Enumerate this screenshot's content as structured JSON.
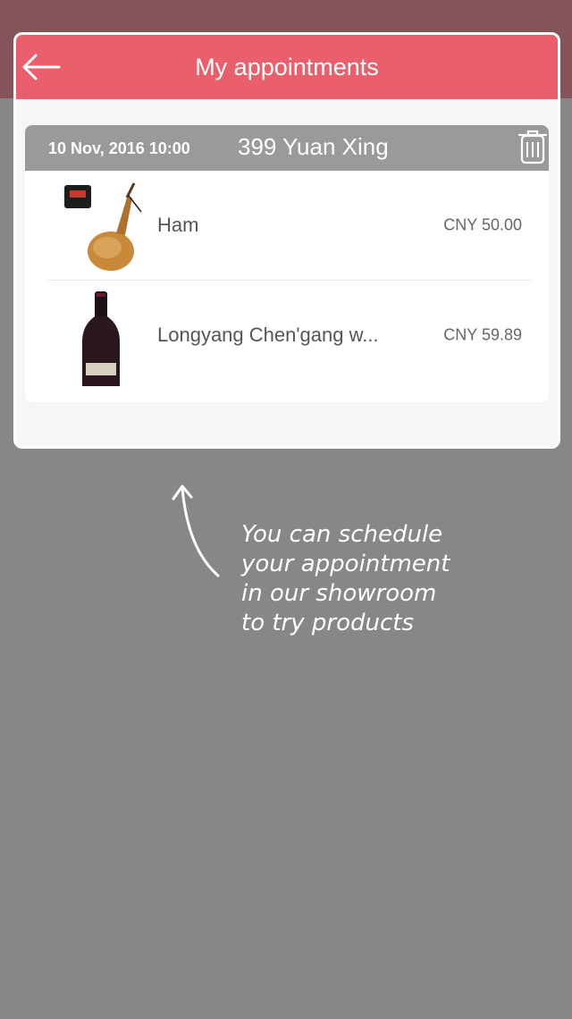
{
  "header": {
    "title": "My appointments"
  },
  "appointment": {
    "date": "10 Nov, 2016 10:00",
    "location": "399 Yuan Xing",
    "items": [
      {
        "name": "Ham",
        "price": "CNY 50.00",
        "image": "ham-image"
      },
      {
        "name": "Longyang Chen'gang w...",
        "price": "CNY 59.89",
        "image": "wine-bottle-image"
      }
    ]
  },
  "tutorial": {
    "lines": [
      "You can schedule",
      "your appointment",
      "in our showroom",
      "to try products"
    ]
  },
  "colors": {
    "accent": "#e95f6b",
    "overlay": "#878787",
    "appointment_bar": "#9a9a9a"
  }
}
